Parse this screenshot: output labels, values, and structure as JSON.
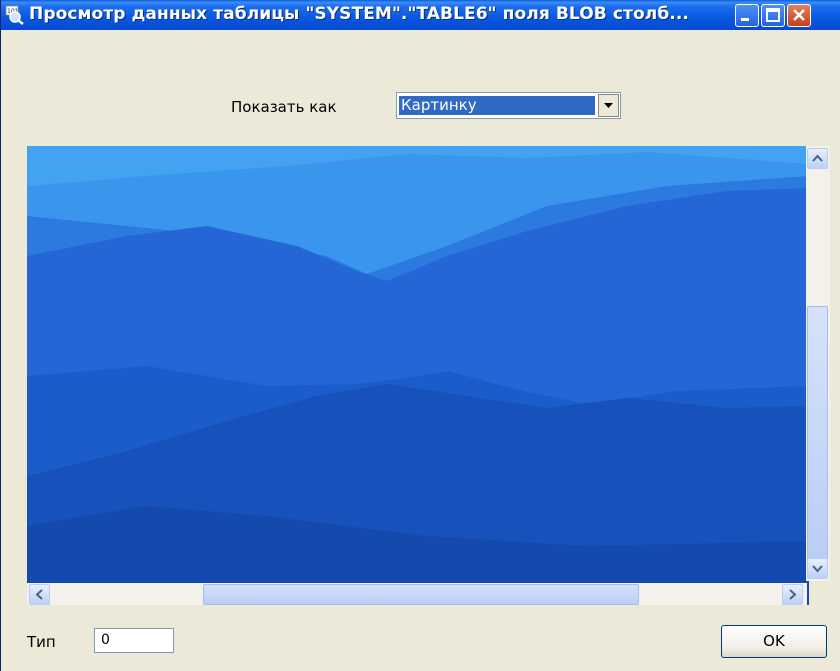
{
  "window": {
    "title": "Просмотр данных таблицы \"SYSTEM\".\"TABLE6\" поля BLOB столб...",
    "icon": "search-document-icon",
    "controls": [
      "minimize-icon",
      "maximize-icon",
      "close-icon"
    ]
  },
  "display": {
    "label": "Показать как",
    "selected": "Картинку"
  },
  "image": {
    "description_icon": "mountain-image",
    "colors": [
      "#41a3f1",
      "#2c79e0",
      "#1a5cca",
      "#164fb6"
    ]
  },
  "scrollbars": {
    "vertical_icons": [
      "arrow-up-icon",
      "arrow-down-icon"
    ],
    "horizontal_icons": [
      "arrow-left-icon",
      "arrow-right-icon"
    ]
  },
  "type": {
    "label": "Тип",
    "value": "0"
  },
  "buttons": {
    "ok": "OK"
  }
}
